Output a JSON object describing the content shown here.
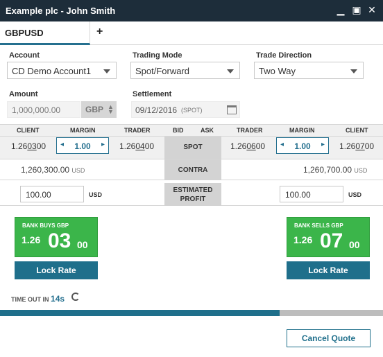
{
  "window": {
    "title": "Example plc - John Smith"
  },
  "tabs": {
    "active": "GBPUSD",
    "add_label": "+"
  },
  "form": {
    "account_label": "Account",
    "account_value": "CD Demo Account1",
    "mode_label": "Trading Mode",
    "mode_value": "Spot/Forward",
    "direction_label": "Trade Direction",
    "direction_value": "Two Way",
    "amount_label": "Amount",
    "amount_value": "1,000,000.00",
    "amount_ccy": "GBP",
    "settlement_label": "Settlement",
    "settlement_date": "09/12/2016",
    "settlement_tenor": "(SPOT)"
  },
  "grid": {
    "headers": {
      "client_l": "CLIENT",
      "margin_l": "MARGIN",
      "trader_l": "TRADER",
      "bid": "BID",
      "ask": "ASK",
      "trader_r": "TRADER",
      "margin_r": "MARGIN",
      "client_r": "CLIENT"
    },
    "bid": {
      "client_pre": "1.26",
      "client_pips": "03",
      "client_post": "00",
      "margin": "1.00",
      "trader_pre": "1.26",
      "trader_pips": "04",
      "trader_post": "00"
    },
    "ask": {
      "trader_pre": "1.26",
      "trader_pips": "06",
      "trader_post": "00",
      "margin": "1.00",
      "client_pre": "1.26",
      "client_pips": "07",
      "client_post": "00"
    },
    "spot_label": "SPOT"
  },
  "contra": {
    "label": "CONTRA",
    "left_value": "1,260,300.00",
    "left_ccy": "USD",
    "right_value": "1,260,700.00",
    "right_ccy": "USD"
  },
  "profit": {
    "label_line1": "ESTIMATED",
    "label_line2": "PROFIT",
    "left_value": "100.00",
    "left_ccy": "USD",
    "right_value": "100.00",
    "right_ccy": "USD"
  },
  "buy_tile": {
    "caption": "BANK BUYS GBP",
    "big1": "1.26",
    "big2": "03",
    "big3": "00",
    "lock_label": "Lock Rate"
  },
  "sell_tile": {
    "caption": "BANK SELLS GBP",
    "big1": "1.26",
    "big2": "07",
    "big3": "00",
    "lock_label": "Lock Rate"
  },
  "timeout": {
    "label": "TIME OUT IN",
    "seconds": "14s"
  },
  "progress": {
    "fraction": 0.73
  },
  "actions": {
    "cancel_label": "Cancel Quote"
  },
  "colors": {
    "titlebar": "#1d2d3a",
    "accent": "#1f6f8b",
    "tile_green": "#3bb54a"
  },
  "icons": [
    "minimize-icon",
    "maximize-icon",
    "close-icon",
    "add-tab-icon",
    "chevron-down-icon",
    "up-down-icon",
    "calendar-icon",
    "chevron-left-icon",
    "chevron-right-icon",
    "refresh-icon"
  ]
}
